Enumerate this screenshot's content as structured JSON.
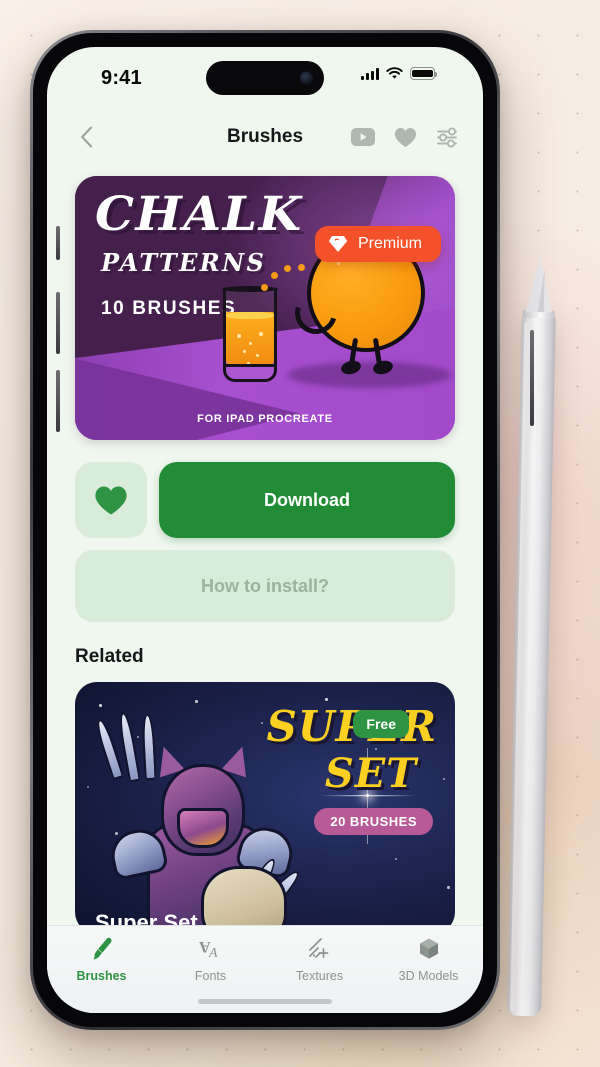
{
  "status_bar": {
    "time": "9:41",
    "signal_icon": "cellular-bars-icon",
    "wifi_icon": "wifi-icon",
    "battery_icon": "battery-full-icon"
  },
  "nav": {
    "back_icon": "chevron-left-icon",
    "title": "Brushes",
    "actions": [
      {
        "name": "youtube-icon",
        "label": "YouTube"
      },
      {
        "name": "heart-icon",
        "label": "Favorites"
      },
      {
        "name": "sliders-icon",
        "label": "Filters"
      }
    ]
  },
  "hero": {
    "title": "CHALK",
    "subtitle": "PATTERNS",
    "count": "10 BRUSHES",
    "footer": "FOR IPAD PROCREATE",
    "badge": {
      "label": "Premium",
      "icon": "diamond-icon",
      "color": "#f4502a"
    },
    "colors": {
      "dark_purple": "#4b2152",
      "light_purple": "#a34ccb",
      "orange": "#fa9b0f"
    }
  },
  "actions": {
    "favorite_icon": "heart-icon",
    "favorite_label": "Favorite",
    "download_label": "Download",
    "download_color": "#228b36",
    "install_label": "How to install?"
  },
  "related": {
    "heading": "Related",
    "card": {
      "title_line1": "SUPER",
      "title_line2": "SET",
      "name": "Super Set",
      "free_badge": "Free",
      "free_badge_color": "#2e9443",
      "brush_badge": "20 BRUSHES",
      "brush_badge_color": "#b85a95"
    }
  },
  "tabbar": {
    "items": [
      {
        "label": "Brushes",
        "icon": "paintbrush-icon",
        "active": true
      },
      {
        "label": "Fonts",
        "icon": "font-aa-icon",
        "active": false
      },
      {
        "label": "Textures",
        "icon": "texture-icon",
        "active": false
      },
      {
        "label": "3D Models",
        "icon": "cube-icon",
        "active": false
      }
    ],
    "active_color": "#2e9443",
    "inactive_color": "#8c9490"
  }
}
